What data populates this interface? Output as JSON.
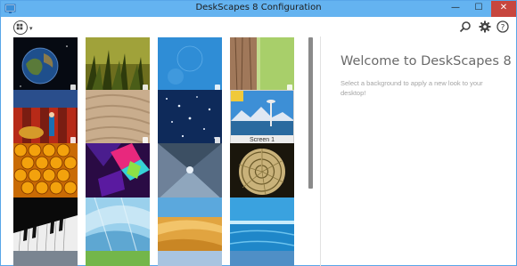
{
  "window": {
    "title": "DeskScapes 8 Configuration",
    "min_glyph": "—",
    "max_glyph": "☐",
    "close_glyph": "✕"
  },
  "toolbar": {
    "menu_icon": "menu-circle-icon",
    "menu_arrow": "▾"
  },
  "top_icons": [
    "search-icon",
    "gear-icon",
    "help-icon"
  ],
  "help_glyph": "?",
  "tiles": [
    {
      "name": "earth",
      "locked": true
    },
    {
      "name": "grass",
      "locked": true
    },
    {
      "name": "blue",
      "locked": true
    },
    {
      "name": "wood",
      "locked": true
    },
    {
      "name": "circus",
      "locked": true
    },
    {
      "name": "sand",
      "locked": true
    },
    {
      "name": "stars",
      "locked": true
    },
    {
      "name": "seattle",
      "locked": false,
      "caption": "Screen 1"
    },
    {
      "name": "honeycomb",
      "locked": false
    },
    {
      "name": "cubes",
      "locked": false
    },
    {
      "name": "tunnel",
      "locked": false
    },
    {
      "name": "nautilus",
      "locked": false
    },
    {
      "name": "piano",
      "locked": false
    },
    {
      "name": "ice",
      "locked": false
    },
    {
      "name": "desert",
      "locked": false
    },
    {
      "name": "sea",
      "locked": false
    }
  ],
  "welcome": {
    "title": "Welcome to DeskScapes 8",
    "text": "Select a background to apply a new look to your desktop!"
  },
  "colors": {
    "titlebar": "#64b3f0",
    "close": "#c7463e",
    "accent_border": "#58a6e8"
  }
}
